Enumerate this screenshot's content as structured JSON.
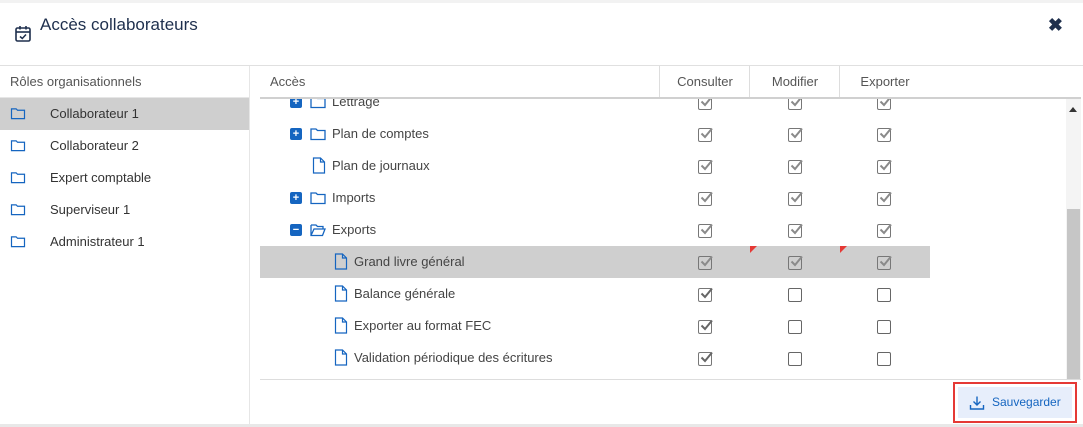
{
  "dialog": {
    "title": "Accès collaborateurs",
    "icon": "calendar-check-icon",
    "close_icon": "close-icon"
  },
  "roles": {
    "header": "Rôles organisationnels",
    "items": [
      {
        "label": "Collaborateur 1",
        "selected": true
      },
      {
        "label": "Collaborateur 2",
        "selected": false
      },
      {
        "label": "Expert comptable",
        "selected": false
      },
      {
        "label": "Superviseur 1",
        "selected": false
      },
      {
        "label": "Administrateur 1",
        "selected": false
      }
    ]
  },
  "table": {
    "columns": {
      "acces": "Accès",
      "consulter": "Consulter",
      "modifier": "Modifier",
      "exporter": "Exporter"
    },
    "rows": [
      {
        "label": "Lettrage",
        "level": 1,
        "toggle": "+",
        "icon": "folder-icon",
        "consulter": true,
        "modifier": true,
        "exporter": true,
        "disabled": true,
        "selected": false
      },
      {
        "label": "Plan de comptes",
        "level": 1,
        "toggle": "+",
        "icon": "folder-icon",
        "consulter": true,
        "modifier": true,
        "exporter": true,
        "disabled": true,
        "selected": false
      },
      {
        "label": "Plan de journaux",
        "level": 1,
        "toggle": "",
        "icon": "file-icon",
        "consulter": true,
        "modifier": true,
        "exporter": true,
        "disabled": true,
        "selected": false
      },
      {
        "label": "Imports",
        "level": 1,
        "toggle": "+",
        "icon": "folder-icon",
        "consulter": true,
        "modifier": true,
        "exporter": true,
        "disabled": true,
        "selected": false
      },
      {
        "label": "Exports",
        "level": 1,
        "toggle": "−",
        "icon": "folder-open-icon",
        "consulter": true,
        "modifier": true,
        "exporter": true,
        "disabled": true,
        "selected": false
      },
      {
        "label": "Grand livre général",
        "level": 2,
        "toggle": "",
        "icon": "file-icon",
        "consulter": true,
        "modifier": true,
        "exporter": true,
        "disabled": true,
        "selected": true
      },
      {
        "label": "Balance générale",
        "level": 2,
        "toggle": "",
        "icon": "file-icon",
        "consulter": true,
        "modifier": false,
        "exporter": false,
        "disabled": false,
        "selected": false
      },
      {
        "label": "Exporter au format FEC",
        "level": 2,
        "toggle": "",
        "icon": "file-icon",
        "consulter": true,
        "modifier": false,
        "exporter": false,
        "disabled": false,
        "selected": false
      },
      {
        "label": "Validation périodique des écritures",
        "level": 2,
        "toggle": "",
        "icon": "file-icon",
        "consulter": true,
        "modifier": false,
        "exporter": false,
        "disabled": false,
        "selected": false
      }
    ]
  },
  "footer": {
    "save_label": "Sauvegarder",
    "save_icon": "download-icon"
  },
  "colors": {
    "accent": "#1565c0",
    "selection": "#cfcfcf",
    "highlight_border": "#e53935"
  }
}
